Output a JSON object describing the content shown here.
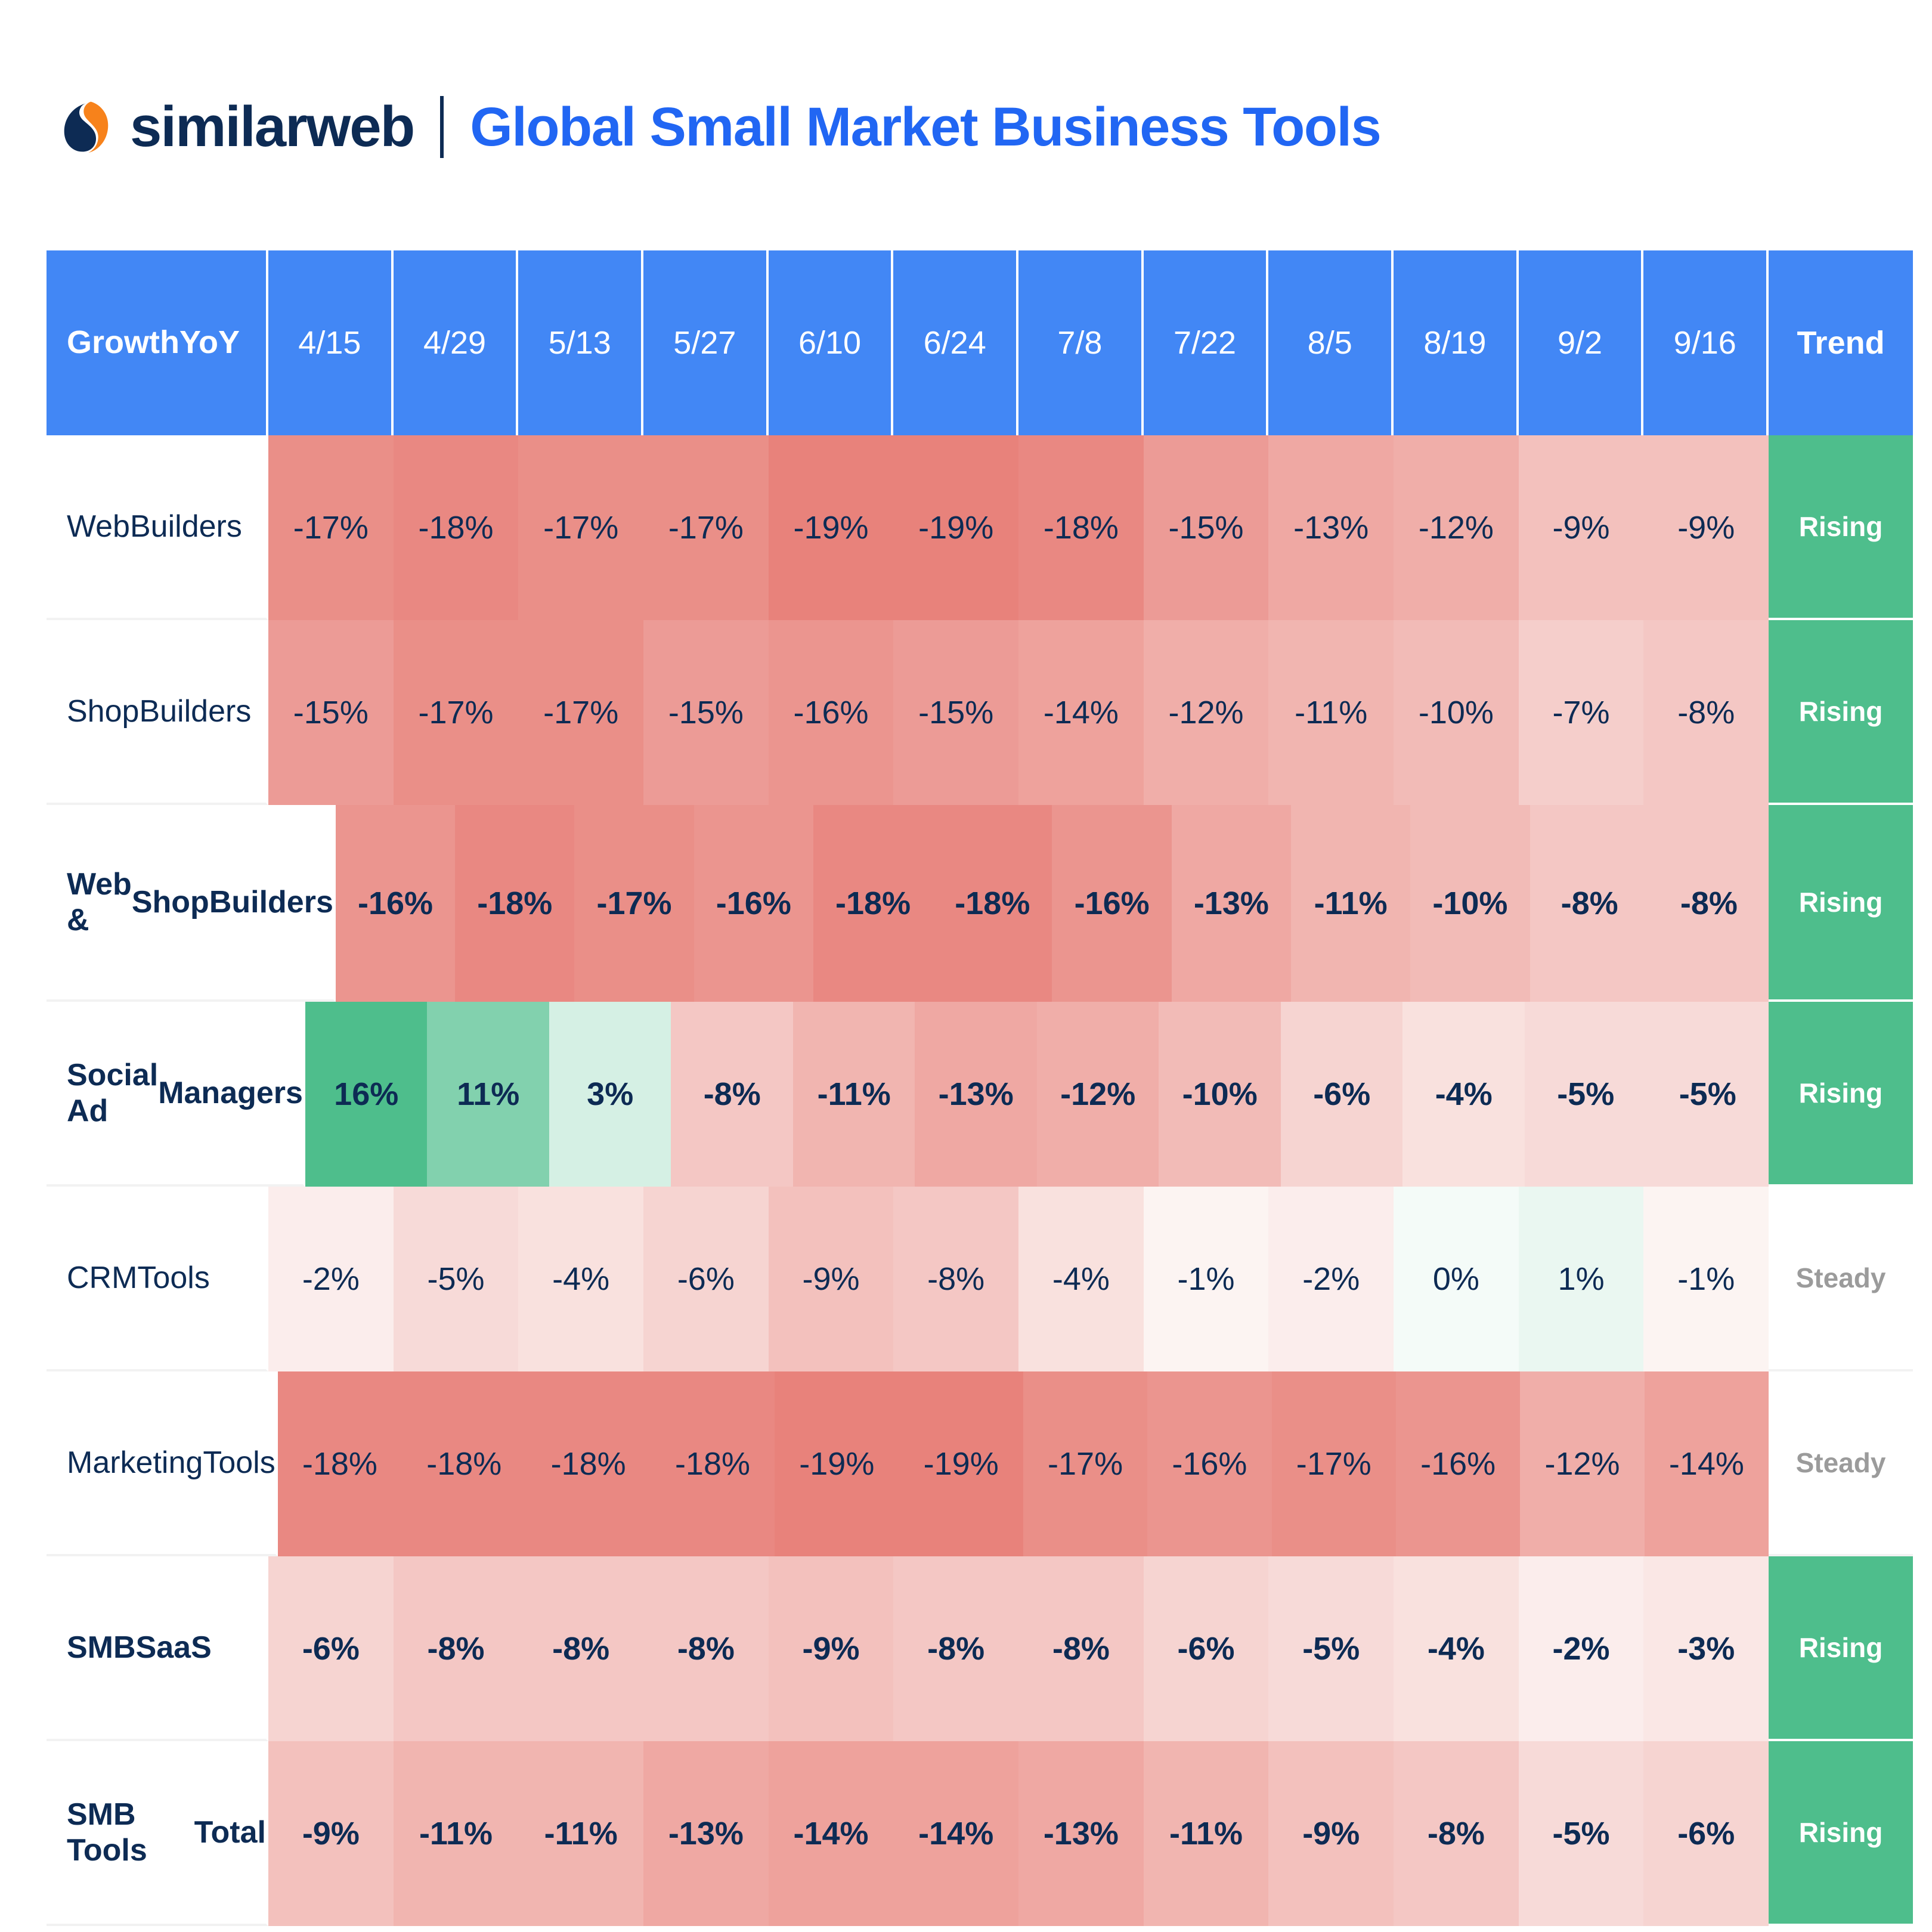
{
  "brand": {
    "logo_name": "similarweb-logo",
    "wordmark": "similarweb",
    "logo_dark": "#0D2B54",
    "logo_accent": "#F7821B"
  },
  "header": {
    "title": "Global Small Market Business Tools",
    "title_color": "#2166F3"
  },
  "table": {
    "corner_label": "Growth\nYoY",
    "corner_label_line1": "Growth",
    "corner_label_line2": "YoY",
    "trend_header": "Trend",
    "header_bg": "#4287F5",
    "dates": [
      "4/15",
      "4/29",
      "5/13",
      "5/27",
      "6/10",
      "6/24",
      "7/8",
      "7/22",
      "8/5",
      "8/19",
      "9/2",
      "9/16"
    ],
    "trend_rising_label": "Rising",
    "trend_steady_label": "Steady",
    "rising_color": "#4EBE8C",
    "steady_color": "#9B9B9B",
    "rows": [
      {
        "label": "Web Builders",
        "label_line1": "Web",
        "label_line2": "Builders",
        "label_line3": "",
        "bold": false,
        "values": [
          "-17%",
          "-18%",
          "-17%",
          "-17%",
          "-19%",
          "-19%",
          "-18%",
          "-15%",
          "-13%",
          "-12%",
          "-9%",
          "-9%"
        ],
        "trend": "Rising"
      },
      {
        "label": "Shop Builders",
        "label_line1": "Shop",
        "label_line2": "Builders",
        "label_line3": "",
        "bold": false,
        "values": [
          "-15%",
          "-17%",
          "-17%",
          "-15%",
          "-16%",
          "-15%",
          "-14%",
          "-12%",
          "-11%",
          "-10%",
          "-7%",
          "-8%"
        ],
        "trend": "Rising"
      },
      {
        "label": "Web & Shop Builders",
        "label_line1": "Web &",
        "label_line2": "Shop",
        "label_line3": "Builders",
        "bold": true,
        "values": [
          "-16%",
          "-18%",
          "-17%",
          "-16%",
          "-18%",
          "-18%",
          "-16%",
          "-13%",
          "-11%",
          "-10%",
          "-8%",
          "-8%"
        ],
        "trend": "Rising"
      },
      {
        "label": "Social Ad Managers",
        "label_line1": "Social Ad",
        "label_line2": "Managers",
        "label_line3": "",
        "bold": true,
        "values": [
          "16%",
          "11%",
          "3%",
          "-8%",
          "-11%",
          "-13%",
          "-12%",
          "-10%",
          "-6%",
          "-4%",
          "-5%",
          "-5%"
        ],
        "trend": "Rising"
      },
      {
        "label": "CRM Tools",
        "label_line1": "CRM",
        "label_line2": "Tools",
        "label_line3": "",
        "bold": false,
        "values": [
          "-2%",
          "-5%",
          "-4%",
          "-6%",
          "-9%",
          "-8%",
          "-4%",
          "-1%",
          "-2%",
          "0%",
          "1%",
          "-1%"
        ],
        "trend": "Steady"
      },
      {
        "label": "Marketing Tools",
        "label_line1": "Marketing",
        "label_line2": "Tools",
        "label_line3": "",
        "bold": false,
        "values": [
          "-18%",
          "-18%",
          "-18%",
          "-18%",
          "-19%",
          "-19%",
          "-17%",
          "-16%",
          "-17%",
          "-16%",
          "-12%",
          "-14%"
        ],
        "trend": "Steady"
      },
      {
        "label": "SMB SaaS",
        "label_line1": "SMB",
        "label_line2": "SaaS",
        "label_line3": "",
        "bold": true,
        "values": [
          "-6%",
          "-8%",
          "-8%",
          "-8%",
          "-9%",
          "-8%",
          "-8%",
          "-6%",
          "-5%",
          "-4%",
          "-2%",
          "-3%"
        ],
        "trend": "Rising"
      },
      {
        "label": "SMB Tools Total",
        "label_line1": "SMB Tools",
        "label_line2": "Total",
        "label_line3": "",
        "bold": true,
        "values": [
          "-9%",
          "-11%",
          "-11%",
          "-13%",
          "-14%",
          "-14%",
          "-13%",
          "-11%",
          "-9%",
          "-8%",
          "-5%",
          "-6%"
        ],
        "trend": "Rising"
      }
    ]
  },
  "chart_data": {
    "type": "heatmap",
    "title": "Global Small Market Business Tools",
    "xlabel": "",
    "ylabel": "Growth YoY",
    "categories": [
      "4/15",
      "4/29",
      "5/13",
      "5/27",
      "6/10",
      "6/24",
      "7/8",
      "7/22",
      "8/5",
      "8/19",
      "9/2",
      "9/16"
    ],
    "series": [
      {
        "name": "Web Builders",
        "values": [
          -17,
          -18,
          -17,
          -17,
          -19,
          -19,
          -18,
          -15,
          -13,
          -12,
          -9,
          -9
        ],
        "trend": "Rising"
      },
      {
        "name": "Shop Builders",
        "values": [
          -15,
          -17,
          -17,
          -15,
          -16,
          -15,
          -14,
          -12,
          -11,
          -10,
          -7,
          -8
        ],
        "trend": "Rising"
      },
      {
        "name": "Web & Shop Builders",
        "values": [
          -16,
          -18,
          -17,
          -16,
          -18,
          -18,
          -16,
          -13,
          -11,
          -10,
          -8,
          -8
        ],
        "trend": "Rising"
      },
      {
        "name": "Social Ad Managers",
        "values": [
          16,
          11,
          3,
          -8,
          -11,
          -13,
          -12,
          -10,
          -6,
          -4,
          -5,
          -5
        ],
        "trend": "Rising"
      },
      {
        "name": "CRM Tools",
        "values": [
          -2,
          -5,
          -4,
          -6,
          -9,
          -8,
          -4,
          -1,
          -2,
          0,
          1,
          -1
        ],
        "trend": "Steady"
      },
      {
        "name": "Marketing Tools",
        "values": [
          -18,
          -18,
          -18,
          -18,
          -19,
          -19,
          -17,
          -16,
          -17,
          -16,
          -12,
          -14
        ],
        "trend": "Steady"
      },
      {
        "name": "SMB SaaS",
        "values": [
          -6,
          -8,
          -8,
          -8,
          -9,
          -8,
          -8,
          -6,
          -5,
          -4,
          -2,
          -3
        ],
        "trend": "Rising"
      },
      {
        "name": "SMB Tools Total",
        "values": [
          -9,
          -11,
          -11,
          -13,
          -14,
          -14,
          -13,
          -11,
          -9,
          -8,
          -5,
          -6
        ],
        "trend": "Rising"
      }
    ],
    "unit": "%",
    "colorscale": {
      "negative_strong": "#E8827B",
      "negative_weak": "#FCF0EE",
      "positive_strong": "#4EBE8C",
      "positive_weak": "#DEF2E8",
      "neutral": "#FAFAFB"
    },
    "legend": "none",
    "grid": false
  }
}
